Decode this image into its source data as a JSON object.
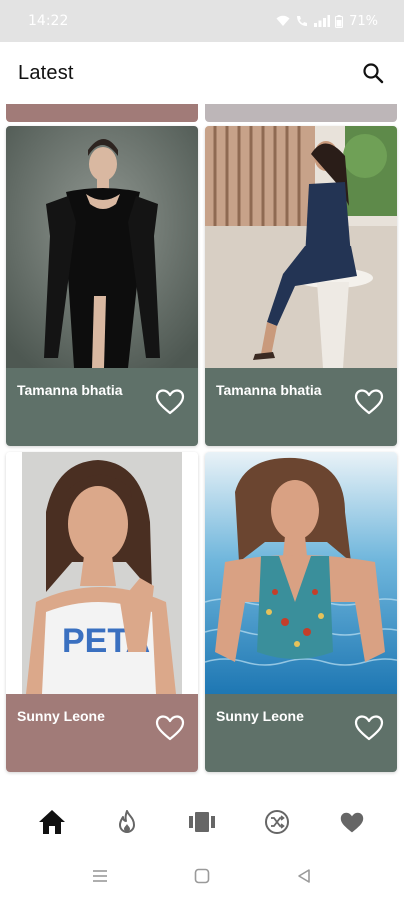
{
  "status_bar": {
    "time": "14:22",
    "battery": "71%",
    "icons": [
      "wifi-icon",
      "wifi-calling-icon",
      "signal-icon",
      "battery-icon"
    ]
  },
  "app_bar": {
    "title": "Latest",
    "search_icon": "search-icon"
  },
  "cards": [
    {
      "name": "Tamanna bhatia",
      "footer_color": "#5f7169",
      "liked": false
    },
    {
      "name": "Tamanna bhatia",
      "footer_color": "#5f7169",
      "liked": false
    },
    {
      "name": "Sunny Leone",
      "footer_color": "#a17b78",
      "liked": false
    },
    {
      "name": "Sunny Leone",
      "footer_color": "#5f7169",
      "liked": false
    }
  ],
  "partial_cards_above": [
    "#a17b78",
    "#bdb6b8"
  ],
  "bottom_nav": {
    "items": [
      {
        "icon": "home-icon",
        "active": true
      },
      {
        "icon": "fire-icon",
        "active": false
      },
      {
        "icon": "carousel-icon",
        "active": false
      },
      {
        "icon": "shuffle-icon",
        "active": false
      },
      {
        "icon": "heart-icon",
        "active": false
      }
    ],
    "active_color": "#111111",
    "inactive_color": "#666666"
  },
  "system_nav": {
    "items": [
      "recents-icon",
      "home-square-icon",
      "back-triangle-icon"
    ]
  },
  "colors": {
    "status_bar_bg": "#e3e3e3",
    "sage_footer": "#5f7169",
    "rose_footer": "#a17b78"
  }
}
